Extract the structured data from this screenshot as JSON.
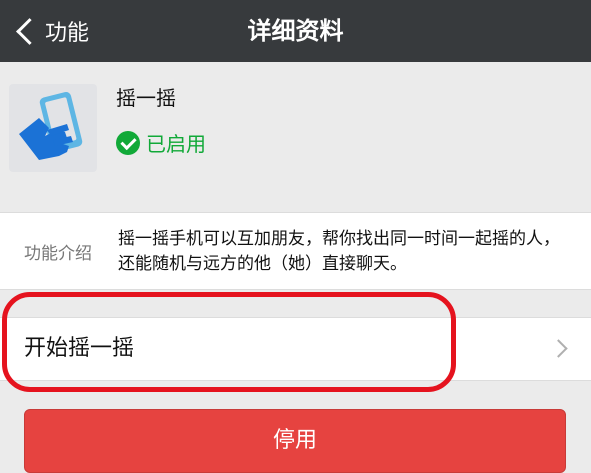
{
  "header": {
    "back_label": "功能",
    "title": "详细资料"
  },
  "profile": {
    "icon": "shake-phone-icon",
    "name": "摇一摇",
    "status": "已启用",
    "status_color": "#11a938"
  },
  "intro": {
    "label": "功能介绍",
    "text": "摇一摇手机可以互加朋友，帮你找出同一时间一起摇的人，还能随机与远方的他（她）直接聊天。"
  },
  "entry": {
    "label": "开始摇一摇"
  },
  "footer": {
    "disable_label": "停用",
    "button_color": "#e64340"
  },
  "annotation": {
    "highlight_color": "#e5131e"
  }
}
